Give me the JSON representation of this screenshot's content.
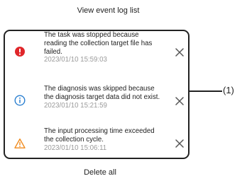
{
  "header": {
    "view_log_label": "View event log list"
  },
  "log": {
    "items": [
      {
        "icon": "error-icon",
        "color": "#e0262a",
        "lines": [
          "The task was stopped because",
          "reading the collection target file has",
          "failed."
        ],
        "timestamp": "2023/01/10 15:59:03"
      },
      {
        "icon": "info-icon",
        "color": "#2a7fd0",
        "lines": [
          "The diagnosis was skipped because",
          "the diagnosis target data did not exist."
        ],
        "timestamp": "2023/01/10 15:21:59"
      },
      {
        "icon": "warning-icon",
        "color": "#f08a1c",
        "lines": [
          "The input processing time exceeded",
          "the collection cycle."
        ],
        "timestamp": "2023/01/10 15:06:11"
      }
    ]
  },
  "callout": {
    "label": "(1)"
  },
  "footer": {
    "delete_all_label": "Delete all"
  }
}
